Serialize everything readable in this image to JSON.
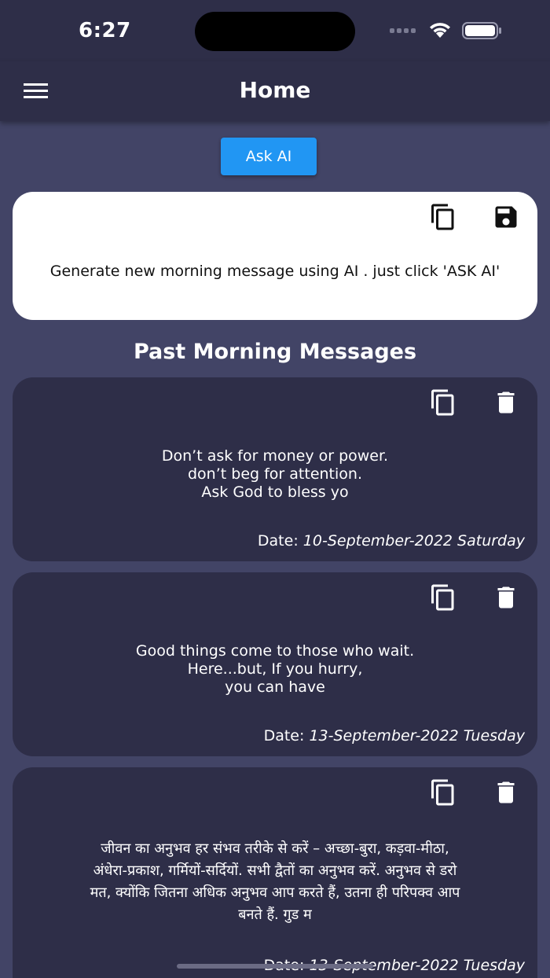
{
  "status_bar": {
    "time": "6:27"
  },
  "app_bar": {
    "title": "Home"
  },
  "ask_button": {
    "label": "Ask AI"
  },
  "ai_card": {
    "message": "Generate new morning message using AI . just click 'ASK AI'"
  },
  "section": {
    "title": "Past Morning Messages"
  },
  "date_label": "Date:",
  "past_messages": [
    {
      "lines": [
        "Don’t ask for money or power.",
        "don’t beg for attention.",
        "Ask God to bless yo"
      ],
      "date": "10-September-2022 Saturday"
    },
    {
      "lines": [
        "Good things come to those who wait.",
        "Here...but, If you hurry,",
        "you can have"
      ],
      "date": "13-September-2022 Tuesday"
    },
    {
      "lines": [
        "जीवन का अनुभव हर संभव तरीके से करें – अच्छा-बुरा, कड़वा-मीठा,",
        "अंधेरा-प्रकाश, गर्मियों-सर्दियों.   सभी द्वैतों का अनुभव करें.  अनुभव से डरो",
        "मत, क्योंकि जितना अधिक अनुभव आप करते हैं, उतना ही परिपक्व आप",
        "बनते हैं. गुड म"
      ],
      "date": "13-September-2022 Tuesday"
    }
  ],
  "colors": {
    "background": "#424466",
    "bar": "#2e2e48",
    "card_dark": "#2e2e48",
    "accent": "#2196f3"
  }
}
